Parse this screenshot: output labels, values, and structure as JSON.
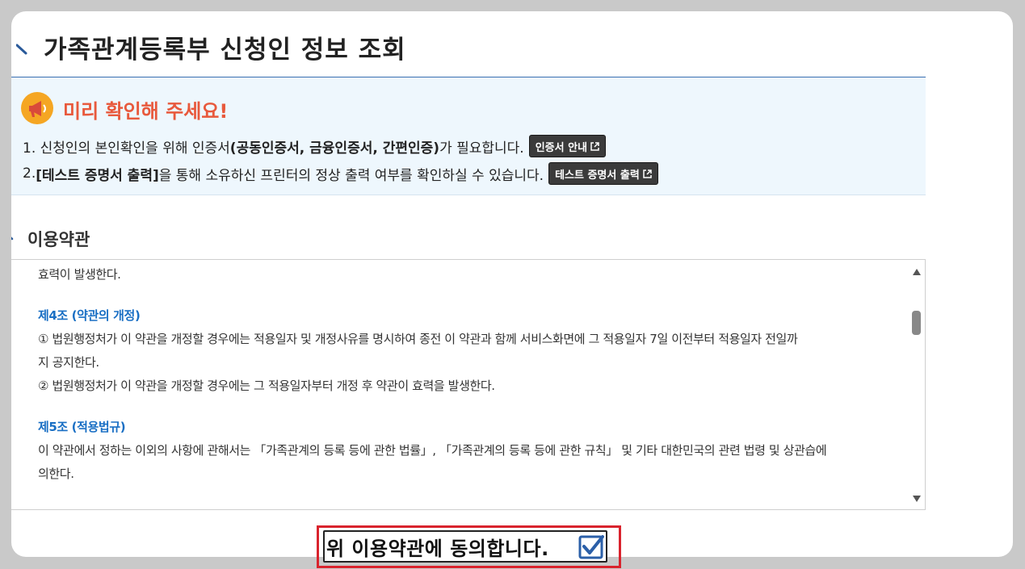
{
  "page": {
    "title": "가족관계등록부 신청인 정보 조회"
  },
  "notice": {
    "heading": "미리 확인해 주세요!",
    "line1": {
      "prefix": "1. 신청인의 본인확인을 위해 인증서",
      "bold": "(공동인증서, 금융인증서, 간편인증)",
      "suffix": "가 필요합니다.",
      "button_label": "인증서 안내"
    },
    "line2": {
      "prefix": "2. ",
      "bold": "[테스트 증명서 출력]",
      "suffix": "을 통해 소유하신 프린터의 정상 출력 여부를 확인하실 수 있습니다.",
      "button_label": "테스트 증명서 출력"
    }
  },
  "terms": {
    "section_title": "이용약관",
    "paragraphs": [
      "효력이 발생한다.",
      "제4조 (약관의 개정)",
      "① 법원행정처가 이 약관을 개정할 경우에는 적용일자 및 개정사유를 명시하여 종전 이 약관과 함께 서비스화면에 그 적용일자 7일 이전부터 적용일자 전일까",
      "지 공지한다.",
      "② 법원행정처가 이 약관을 개정할 경우에는 그 적용일자부터 개정 후 약관이 효력을 발생한다.",
      "제5조 (적용법규)",
      "이 약관에서 정하는 이외의 사항에 관해서는 「가족관계의 등록 등에 관한 법률」, 「가족관계의 등록 등에 관한 규칙」 및 기타 대한민국의 관련 법령 및 상관습에",
      "의한다."
    ]
  },
  "agree": {
    "label": "위 이용약관에 동의합니다.",
    "checked": true
  },
  "colors": {
    "accent_heading": "#e8593c",
    "article_heading": "#1a6fc4",
    "highlight_border": "#d9232d",
    "notice_bg": "#eef7fd",
    "checkbox_blue": "#2b5fa8"
  },
  "icons": {
    "notice": "megaphone-icon",
    "external": "external-link-icon",
    "checkbox": "checkbox-checked-icon"
  }
}
